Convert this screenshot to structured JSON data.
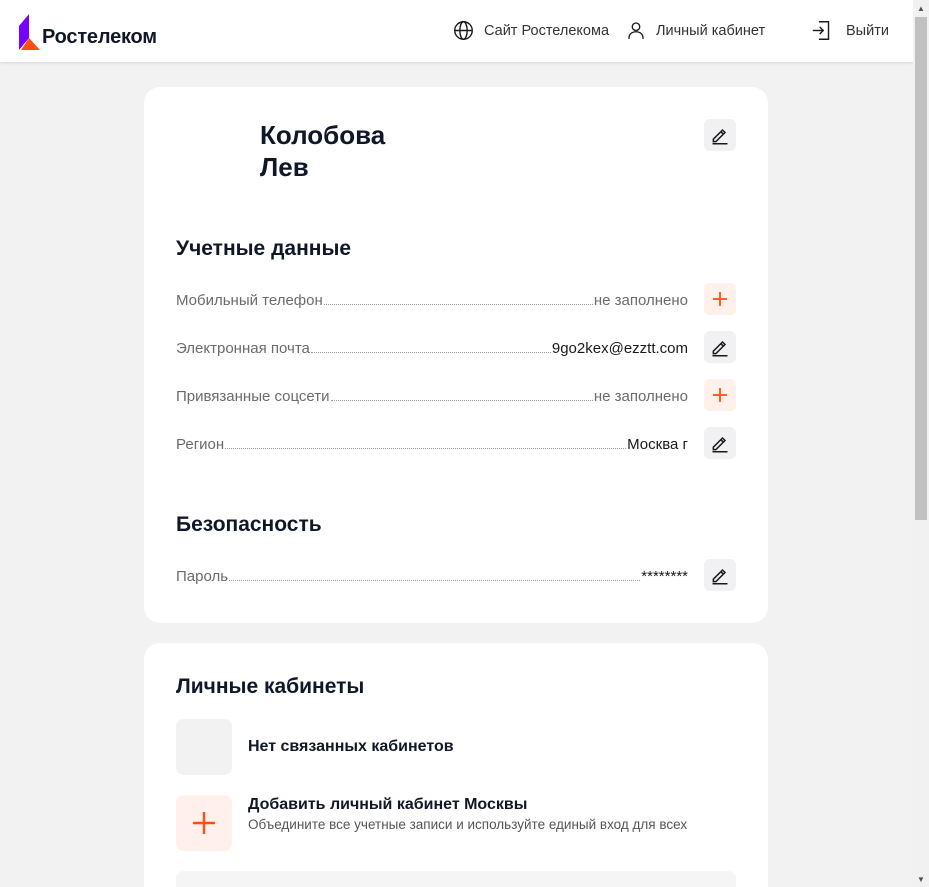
{
  "header": {
    "brand": "Ростелеком",
    "nav": {
      "site_label": "Сайт Ростелекома",
      "cabinet_label": "Личный кабинет",
      "logout_label": "Выйти"
    }
  },
  "profile": {
    "last_name": "Колобова",
    "first_name": "Лев"
  },
  "account": {
    "title": "Учетные данные",
    "rows": [
      {
        "label": "Мобильный телефон",
        "value": "не заполнено",
        "action": "plus-icon"
      },
      {
        "label": "Электронная почта",
        "value": "9go2kex@ezztt.com",
        "action": "pencil-icon"
      },
      {
        "label": "Привязанные соцсети",
        "value": "не заполнено",
        "action": "plus-icon"
      },
      {
        "label": "Регион",
        "value": "Москва г",
        "action": "pencil-icon"
      }
    ]
  },
  "security": {
    "title": "Безопасность",
    "rows": [
      {
        "label": "Пароль",
        "value": "********",
        "action": "pencil-icon"
      }
    ]
  },
  "cabinets": {
    "title": "Личные кабинеты",
    "empty_label": "Нет связанных кабинетов",
    "add_title": "Добавить личный кабинет Москвы",
    "add_subtitle": "Объедините все учетные записи и используйте единый вход для всех"
  },
  "colors": {
    "accent": "#ff4f12",
    "brand_purple": "#7700ff",
    "background": "#f2f2f2"
  }
}
